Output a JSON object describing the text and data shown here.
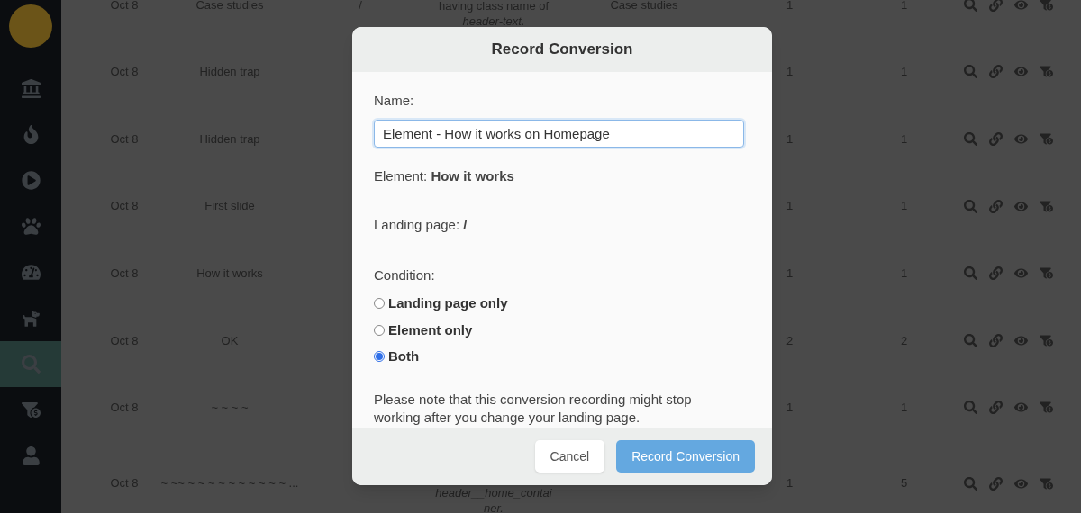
{
  "sidebar": {
    "items": [
      {
        "selected": false
      },
      {
        "selected": false
      },
      {
        "selected": false
      },
      {
        "selected": false
      },
      {
        "selected": false
      },
      {
        "selected": false
      },
      {
        "selected": true
      },
      {
        "selected": false
      },
      {
        "selected": false
      }
    ]
  },
  "table": {
    "rows": [
      {
        "date": "Oct 8",
        "name": "Case studies",
        "column_3": "/",
        "column_4": [
          "having class name of",
          "*header-text.*"
        ],
        "column_5": "Case studies",
        "column_6": "1",
        "column_7": "1"
      },
      {
        "date": "Oct 8",
        "name": "Hidden trap",
        "column_6": "1",
        "column_7": "1"
      },
      {
        "date": "Oct 8",
        "name": "Hidden trap",
        "column_6": "1",
        "column_7": "1"
      },
      {
        "date": "Oct 8",
        "name": "First slide",
        "column_6": "1",
        "column_7": "1"
      },
      {
        "date": "Oct 8",
        "name": "How it works",
        "column_6": "1",
        "column_7": "1"
      },
      {
        "date": "Oct 8",
        "name": "OK",
        "column_6": "2",
        "column_7": "2"
      },
      {
        "date": "Oct 8",
        "name": "~ ~ ~ ~",
        "column_6": "1",
        "column_7": "1"
      },
      {
        "date": "Oct 8",
        "name": "~ ~~ ~ ~ ~ ~ ~ ~ ~ ~ ~ ~ ...",
        "column_4": [
          "*header__home_contai*",
          "*ner.*"
        ],
        "column_6": "1",
        "column_7": "5"
      }
    ]
  },
  "dialog": {
    "title": "Record Conversion",
    "name_label": "Name:",
    "name_value": "Element - How it works on Homepage",
    "element": "Element: **How it works**",
    "landing_page": "Landing page: **/**",
    "condition_label": "Condition:",
    "conditions": [
      {
        "label": "Landing page only",
        "selected": false
      },
      {
        "label": "Element only",
        "selected": false
      },
      {
        "label": "Both",
        "selected": true
      }
    ],
    "note": "Please note that this conversion recording might stop working after you change your landing page.",
    "buttons": [
      {
        "label": "Cancel",
        "kind": "secondary"
      },
      {
        "label": "Record Conversion",
        "kind": "primary"
      }
    ]
  }
}
